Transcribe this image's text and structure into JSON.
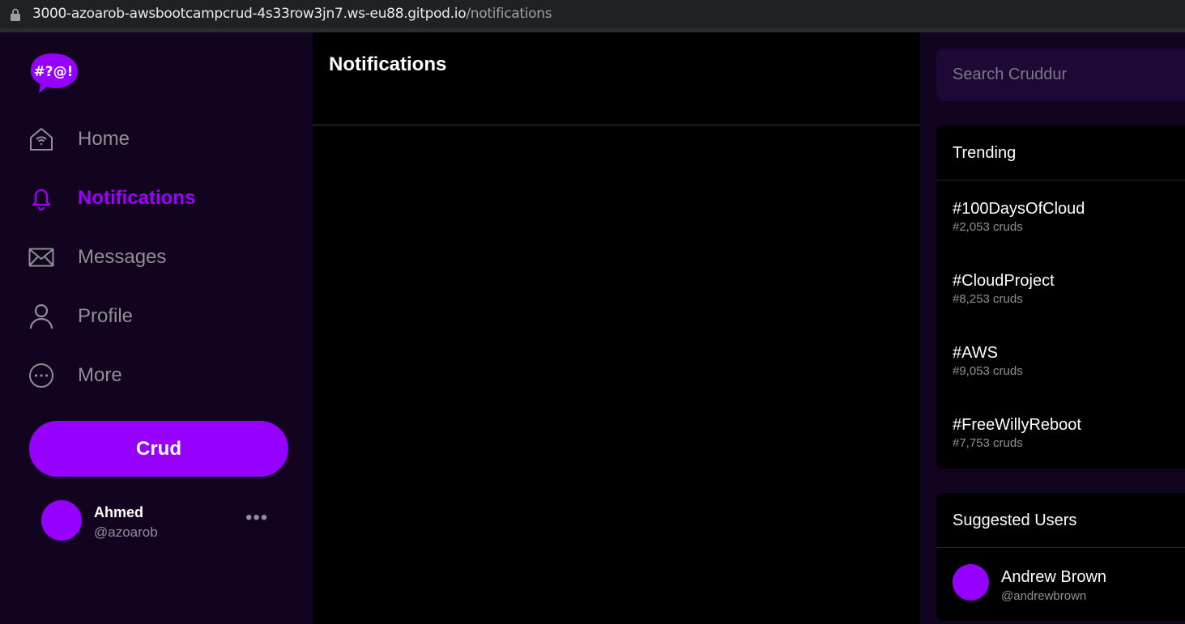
{
  "browser": {
    "url_host": "3000-azoarob-awsbootcampcrud-4s33row3jn7.ws-eu88.gitpod.io",
    "url_path": "/notifications",
    "lock_icon": "lock-icon"
  },
  "brand": {
    "logo_text": "#?@!",
    "accent_color": "#9500ff"
  },
  "nav": {
    "items": [
      {
        "label": "Home",
        "icon": "home-icon"
      },
      {
        "label": "Notifications",
        "icon": "bell-icon",
        "active": true
      },
      {
        "label": "Messages",
        "icon": "envelope-icon"
      },
      {
        "label": "Profile",
        "icon": "person-icon"
      },
      {
        "label": "More",
        "icon": "ellipsis-circle-icon"
      }
    ],
    "crud_button": "Crud"
  },
  "current_user": {
    "name": "Ahmed",
    "handle": "@azoarob",
    "more": "•••"
  },
  "main": {
    "title": "Notifications"
  },
  "search": {
    "placeholder": "Search Cruddur"
  },
  "trending": {
    "title": "Trending",
    "items": [
      {
        "tag": "#100DaysOfCloud",
        "count": "#2,053 cruds"
      },
      {
        "tag": "#CloudProject",
        "count": "#8,253 cruds"
      },
      {
        "tag": "#AWS",
        "count": "#9,053 cruds"
      },
      {
        "tag": "#FreeWillyReboot",
        "count": "#7,753 cruds"
      }
    ]
  },
  "suggested": {
    "title": "Suggested Users",
    "users": [
      {
        "name": "Andrew Brown",
        "handle": "@andrewbrown"
      }
    ]
  }
}
